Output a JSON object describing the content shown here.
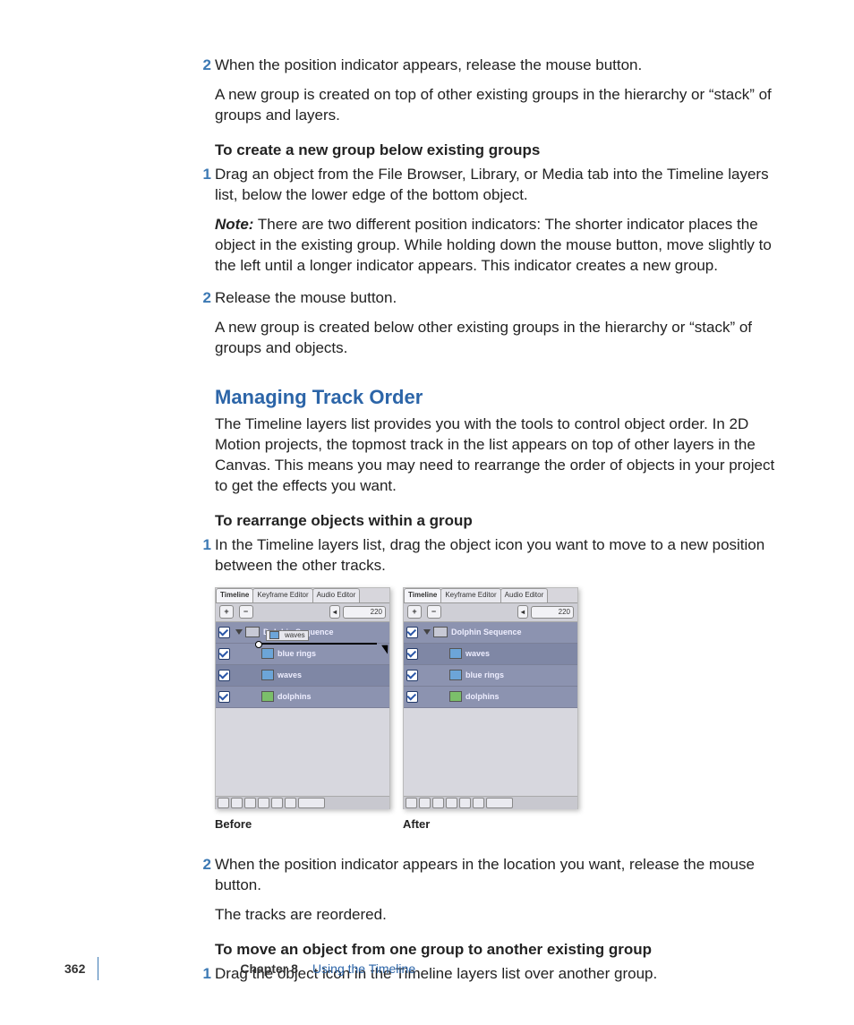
{
  "step2a": "When the position indicator appears, release the mouse button.",
  "step2a_follow": "A new group is created on top of other existing groups in the hierarchy or “stack” of groups and layers.",
  "sub1": "To create a new group below existing groups",
  "step1a": "Drag an object from the File Browser, Library, or Media tab into the Timeline layers list, below the lower edge of the bottom object.",
  "note_label": "Note:",
  "note_body": "  There are two different position indicators: The shorter indicator places the object in the existing group. While holding down the mouse button, move slightly to the left until a longer indicator appears. This indicator creates a new group.",
  "step2b": "Release the mouse button.",
  "step2b_follow": "A new group is created below other existing groups in the hierarchy or “stack” of groups and objects.",
  "h2": "Managing Track Order",
  "h2_body": "The Timeline layers list provides you with the tools to control object order. In 2D Motion projects, the topmost track in the list appears on top of other layers in the Canvas. This means you may need to rearrange the order of objects in your project to get the effects you want.",
  "sub2": "To rearrange objects within a group",
  "step1b": "In the Timeline layers list, drag the object icon you want to move to a new position between the other tracks.",
  "fig_before": {
    "tabs": [
      "Timeline",
      "Keyframe Editor",
      "Audio Editor"
    ],
    "toolbar_value": "220",
    "group": "Dolphin Sequence",
    "drag_label": "waves",
    "layers": [
      "blue rings",
      "waves",
      "dolphins"
    ],
    "selected_index": 1,
    "caption": "Before"
  },
  "fig_after": {
    "tabs": [
      "Timeline",
      "Keyframe Editor",
      "Audio Editor"
    ],
    "toolbar_value": "220",
    "group": "Dolphin Sequence",
    "layers": [
      "waves",
      "blue rings",
      "dolphins"
    ],
    "selected_index": 0,
    "caption": "After"
  },
  "step2c": "When the position indicator appears in the location you want, release the mouse button.",
  "step2c_follow": "The tracks are reordered.",
  "sub3": "To move an object from one group to another existing group",
  "step1c": "Drag the object icon in the Timeline layers list over another group.",
  "page_num": "362",
  "chapter": "Chapter 8",
  "chapter_title": "Using the Timeline",
  "nums": {
    "n1": "1",
    "n2": "2"
  }
}
